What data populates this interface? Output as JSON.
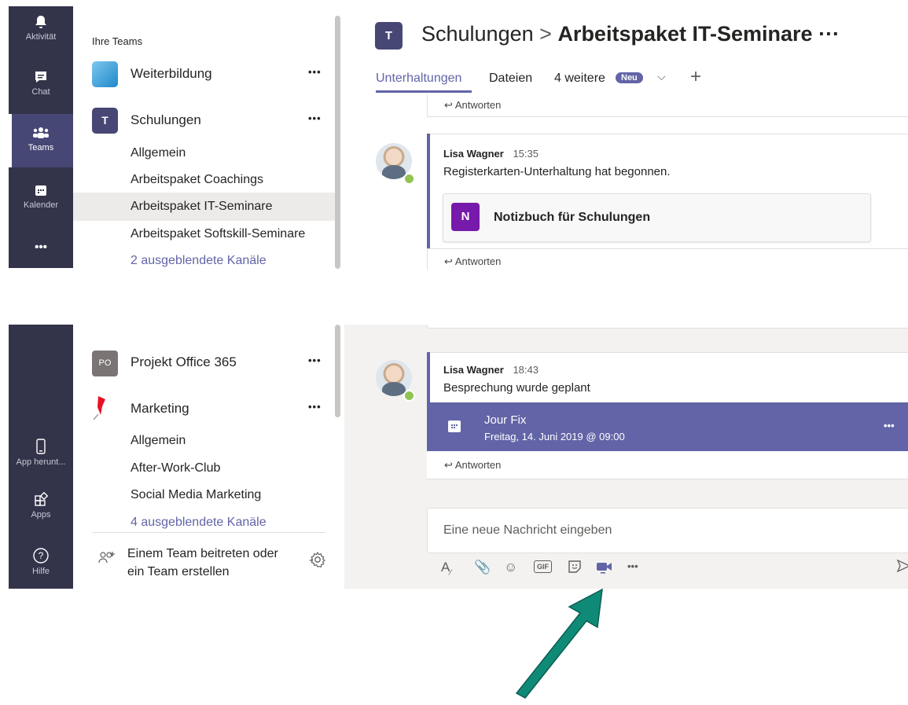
{
  "rail": {
    "activity": "Aktivität",
    "chat": "Chat",
    "teams": "Teams",
    "calendar": "Kalender",
    "more": "•••",
    "download": "App herunt...",
    "apps": "Apps",
    "help": "Hilfe"
  },
  "sidebar": {
    "section_title": "Ihre Teams",
    "teams_top": [
      {
        "name": "Weiterbildung",
        "more": "•••"
      },
      {
        "name": "Schulungen",
        "more": "•••"
      }
    ],
    "channels_top": [
      "Allgemein",
      "Arbeitspaket Coachings",
      "Arbeitspaket IT-Seminare",
      "Arbeitspaket Softskill-Seminare"
    ],
    "hidden_top": "2 ausgeblendete Kanäle",
    "team_po": {
      "initials": "PO",
      "name": "Projekt Office 365",
      "more": "•••"
    },
    "team_marketing": {
      "name": "Marketing",
      "more": "•••"
    },
    "channels_bottom": [
      "Allgemein",
      "After-Work-Club",
      "Social Media Marketing"
    ],
    "hidden_bottom": "4 ausgeblendete Kanäle",
    "join": "Einem Team beitreten oder ein Team erstellen"
  },
  "header": {
    "team": "Schulungen",
    "separator": ">",
    "channel": "Arbeitspaket IT-Seminare",
    "more": "···",
    "tabs": [
      "Unterhaltungen",
      "Dateien",
      "4 weitere"
    ],
    "badge": "Neu",
    "add": "+"
  },
  "reply_label": "Antworten",
  "messages": [
    {
      "author": "Lisa Wagner",
      "time": "15:35",
      "text": "Registerkarten-Unterhaltung hat begonnen.",
      "card": "Notizbuch für Schulungen"
    },
    {
      "author": "Lisa Wagner",
      "time": "18:43",
      "text": "Besprechung wurde geplant",
      "meeting_title": "Jour Fix",
      "meeting_date": "Freitag, 14. Juni 2019 @ 09:00",
      "meeting_more": "•••"
    }
  ],
  "compose": {
    "placeholder": "Eine neue Nachricht eingeben",
    "gif": "GIF",
    "more": "•••"
  },
  "colors": {
    "rail": "#33344a",
    "accent": "#6264a7",
    "arrow": "#0f8a76"
  }
}
